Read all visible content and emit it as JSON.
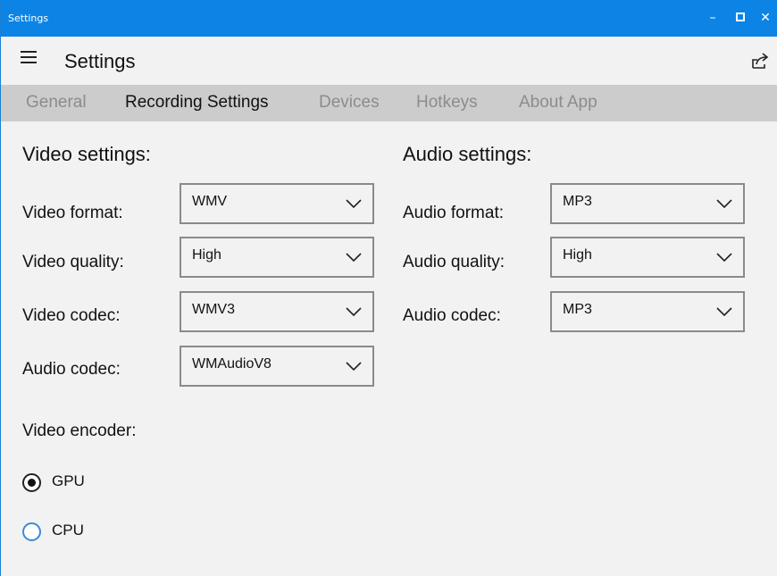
{
  "window": {
    "title": "Settings"
  },
  "appbar": {
    "title": "Settings"
  },
  "tabs": [
    {
      "label": "General",
      "active": false
    },
    {
      "label": "Recording Settings",
      "active": true
    },
    {
      "label": "Devices",
      "active": false
    },
    {
      "label": "Hotkeys",
      "active": false
    },
    {
      "label": "About App",
      "active": false
    }
  ],
  "video": {
    "title": "Video settings:",
    "format": {
      "label": "Video format:",
      "value": "WMV"
    },
    "quality": {
      "label": "Video quality:",
      "value": "High"
    },
    "codec": {
      "label": "Video codec:",
      "value": "WMV3"
    },
    "audio_codec": {
      "label": "Audio codec:",
      "value": "WMAudioV8"
    },
    "encoder": {
      "label": "Video encoder:",
      "options": [
        {
          "label": "GPU",
          "selected": true
        },
        {
          "label": "CPU",
          "selected": false
        }
      ]
    }
  },
  "audio": {
    "title": "Audio settings:",
    "format": {
      "label": "Audio format:",
      "value": "MP3"
    },
    "quality": {
      "label": "Audio quality:",
      "value": "High"
    },
    "codec": {
      "label": "Audio codec:",
      "value": "MP3"
    }
  },
  "colors": {
    "titlebar": "#0b84e6",
    "tabbar": "#cccccc",
    "background": "#f2f2f2"
  },
  "icons": [
    "hamburger-icon",
    "share-icon",
    "minimize-icon",
    "maximize-icon",
    "close-icon",
    "chevron-down-icon"
  ]
}
